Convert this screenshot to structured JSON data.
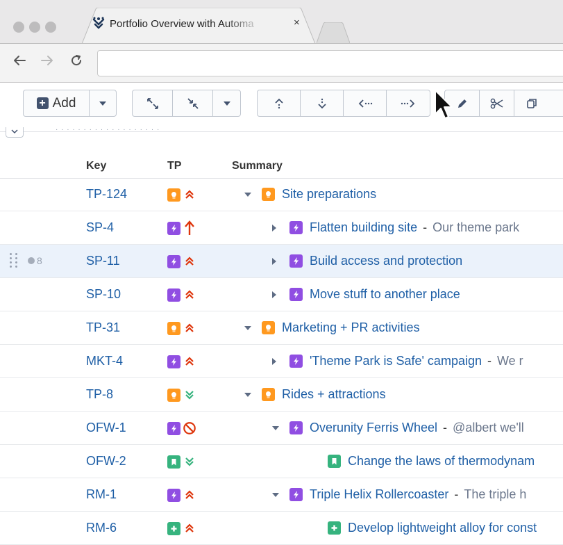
{
  "browser": {
    "tab_title": "Portfolio Overview with Automa",
    "tab_close": "×",
    "url": ""
  },
  "toolbar": {
    "add_label": "Add",
    "clipped_line": "· · · · · · · · · · · · · · · · · · ·"
  },
  "grid": {
    "columns": {
      "key": "Key",
      "tp": "TP",
      "summary": "Summary"
    },
    "rows": [
      {
        "key": "TP-124",
        "type": "epic",
        "priority": "high",
        "toggle": "down",
        "level": 0,
        "title": "Site preparations",
        "desc": ""
      },
      {
        "key": "SP-4",
        "type": "story",
        "priority": "highest",
        "toggle": "right",
        "level": 1,
        "title": "Flatten building site",
        "desc": "Our theme park"
      },
      {
        "key": "SP-11",
        "type": "story",
        "priority": "high",
        "toggle": "right",
        "level": 1,
        "title": "Build access and protection",
        "desc": "",
        "selected": true,
        "watchers": "8"
      },
      {
        "key": "SP-10",
        "type": "story",
        "priority": "high",
        "toggle": "right",
        "level": 1,
        "title": "Move stuff to another place",
        "desc": ""
      },
      {
        "key": "TP-31",
        "type": "epic",
        "priority": "high",
        "toggle": "down",
        "level": 0,
        "title": "Marketing + PR activities",
        "desc": ""
      },
      {
        "key": "MKT-4",
        "type": "story",
        "priority": "high",
        "toggle": "right",
        "level": 1,
        "title": "'Theme Park is Safe' campaign",
        "desc": "We r"
      },
      {
        "key": "TP-8",
        "type": "epic",
        "priority": "low",
        "toggle": "down",
        "level": 0,
        "title": "Rides + attractions",
        "desc": ""
      },
      {
        "key": "OFW-1",
        "type": "story",
        "priority": "blocker",
        "toggle": "down",
        "level": 1,
        "title": "Overunity Ferris Wheel",
        "desc": "@albert we'll"
      },
      {
        "key": "OFW-2",
        "type": "bug",
        "priority": "low",
        "toggle": "none",
        "level": 2,
        "title": "Change the laws of thermodynam",
        "desc": ""
      },
      {
        "key": "RM-1",
        "type": "story",
        "priority": "high",
        "toggle": "down",
        "level": 1,
        "title": "Triple Helix Rollercoaster",
        "desc": "The triple h"
      },
      {
        "key": "RM-6",
        "type": "task",
        "priority": "high",
        "toggle": "none",
        "level": 2,
        "title": "Develop lightweight alloy for const",
        "desc": ""
      }
    ]
  },
  "icons": {
    "epic": "lightbulb-icon",
    "story": "lightning-icon",
    "bug": "bookmark-icon",
    "task": "plus-icon"
  },
  "colors": {
    "epic": "#ff991f",
    "story": "#904ee2",
    "bug": "#36b37e",
    "task": "#36b37e",
    "priority_high": "#de350b",
    "priority_low": "#36b37e",
    "link": "#1f5fa6",
    "selected_row": "#ebf2fb"
  }
}
